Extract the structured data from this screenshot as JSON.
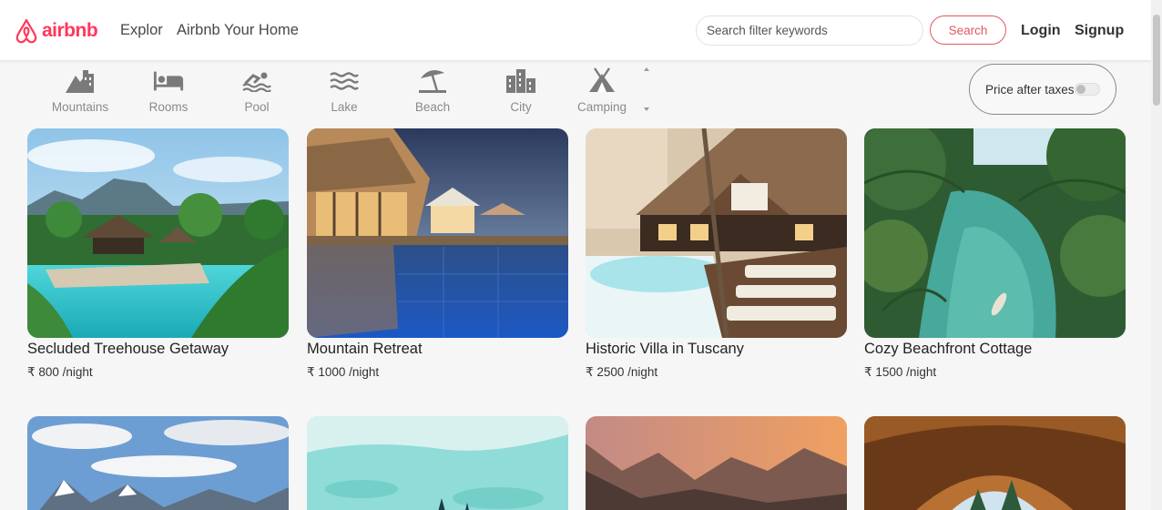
{
  "brand": {
    "name": "airbnb",
    "color": "#ff385c"
  },
  "nav": {
    "links": [
      "Explor",
      "Airbnb Your Home"
    ],
    "search_placeholder": "Search filter keywords",
    "search_button": "Search",
    "login": "Login",
    "signup": "Signup"
  },
  "filters": [
    {
      "label": "Mountains",
      "icon": "mountain-city-icon"
    },
    {
      "label": "Rooms",
      "icon": "bed-icon"
    },
    {
      "label": "Pool",
      "icon": "swimmer-icon"
    },
    {
      "label": "Lake",
      "icon": "water-icon"
    },
    {
      "label": "Beach",
      "icon": "umbrella-beach-icon"
    },
    {
      "label": "City",
      "icon": "city-icon"
    },
    {
      "label": "Camping",
      "icon": "campground-icon"
    }
  ],
  "tax_toggle": {
    "label": "Price after taxes",
    "enabled": false
  },
  "listings": [
    {
      "title": "Secluded Treehouse Getaway",
      "price": "₹ 800 /night"
    },
    {
      "title": "Mountain Retreat",
      "price": "₹ 1000 /night"
    },
    {
      "title": "Historic Villa in Tuscany",
      "price": "₹ 2500 /night"
    },
    {
      "title": "Cozy Beachfront Cottage",
      "price": "₹ 1500 /night"
    }
  ],
  "colors": {
    "accent": "#e05861",
    "muted_text": "#8a8a8a",
    "background": "#f6f6f6"
  }
}
